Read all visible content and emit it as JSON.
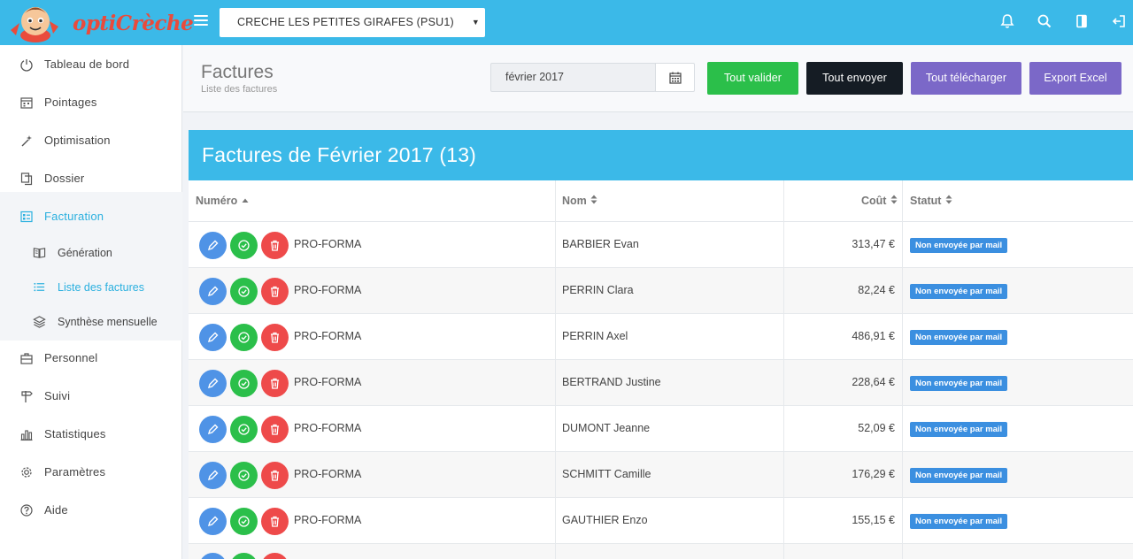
{
  "header": {
    "logo_text": "optiCrèche",
    "creche_select": "CRECHE LES PETITES GIRAFES (PSU1)"
  },
  "sidebar": {
    "items": [
      {
        "label": "Tableau de bord"
      },
      {
        "label": "Pointages"
      },
      {
        "label": "Optimisation"
      },
      {
        "label": "Dossier"
      },
      {
        "label": "Facturation"
      },
      {
        "label": "Personnel"
      },
      {
        "label": "Suivi"
      },
      {
        "label": "Statistiques"
      },
      {
        "label": "Paramètres"
      },
      {
        "label": "Aide"
      }
    ],
    "sub_items": [
      {
        "label": "Génération"
      },
      {
        "label": "Liste des factures"
      },
      {
        "label": "Synthèse mensuelle"
      }
    ]
  },
  "page": {
    "title": "Factures",
    "subtitle": "Liste des factures",
    "month_value": "février 2017",
    "btn_validate": "Tout valider",
    "btn_send": "Tout envoyer",
    "btn_download": "Tout télécharger",
    "btn_export": "Export Excel"
  },
  "colors": {
    "topbar": "#3bb9e8",
    "validate": "#2bbf4a",
    "send": "#151c24",
    "download": "#7b68c8",
    "active": "#2bb0df",
    "edit": "#4f93e6",
    "ok": "#2bbf4a",
    "delete": "#ee4a4a",
    "badge": "#3b8fe0"
  },
  "panel": {
    "title": "Factures de Février 2017 (13)"
  },
  "table": {
    "headers": {
      "numero": "Numéro",
      "nom": "Nom",
      "cout": "Coût",
      "statut": "Statut"
    },
    "rows": [
      {
        "numero": "PRO-FORMA",
        "nom": "BARBIER Evan",
        "cout": "313,47 €",
        "statut": "Non envoyée par mail"
      },
      {
        "numero": "PRO-FORMA",
        "nom": "PERRIN Clara",
        "cout": "82,24 €",
        "statut": "Non envoyée par mail"
      },
      {
        "numero": "PRO-FORMA",
        "nom": "PERRIN Axel",
        "cout": "486,91 €",
        "statut": "Non envoyée par mail"
      },
      {
        "numero": "PRO-FORMA",
        "nom": "BERTRAND Justine",
        "cout": "228,64 €",
        "statut": "Non envoyée par mail"
      },
      {
        "numero": "PRO-FORMA",
        "nom": "DUMONT Jeanne",
        "cout": "52,09 €",
        "statut": "Non envoyée par mail"
      },
      {
        "numero": "PRO-FORMA",
        "nom": "SCHMITT Camille",
        "cout": "176,29 €",
        "statut": "Non envoyée par mail"
      },
      {
        "numero": "PRO-FORMA",
        "nom": "GAUTHIER Enzo",
        "cout": "155,15 €",
        "statut": "Non envoyée par mail"
      }
    ]
  }
}
